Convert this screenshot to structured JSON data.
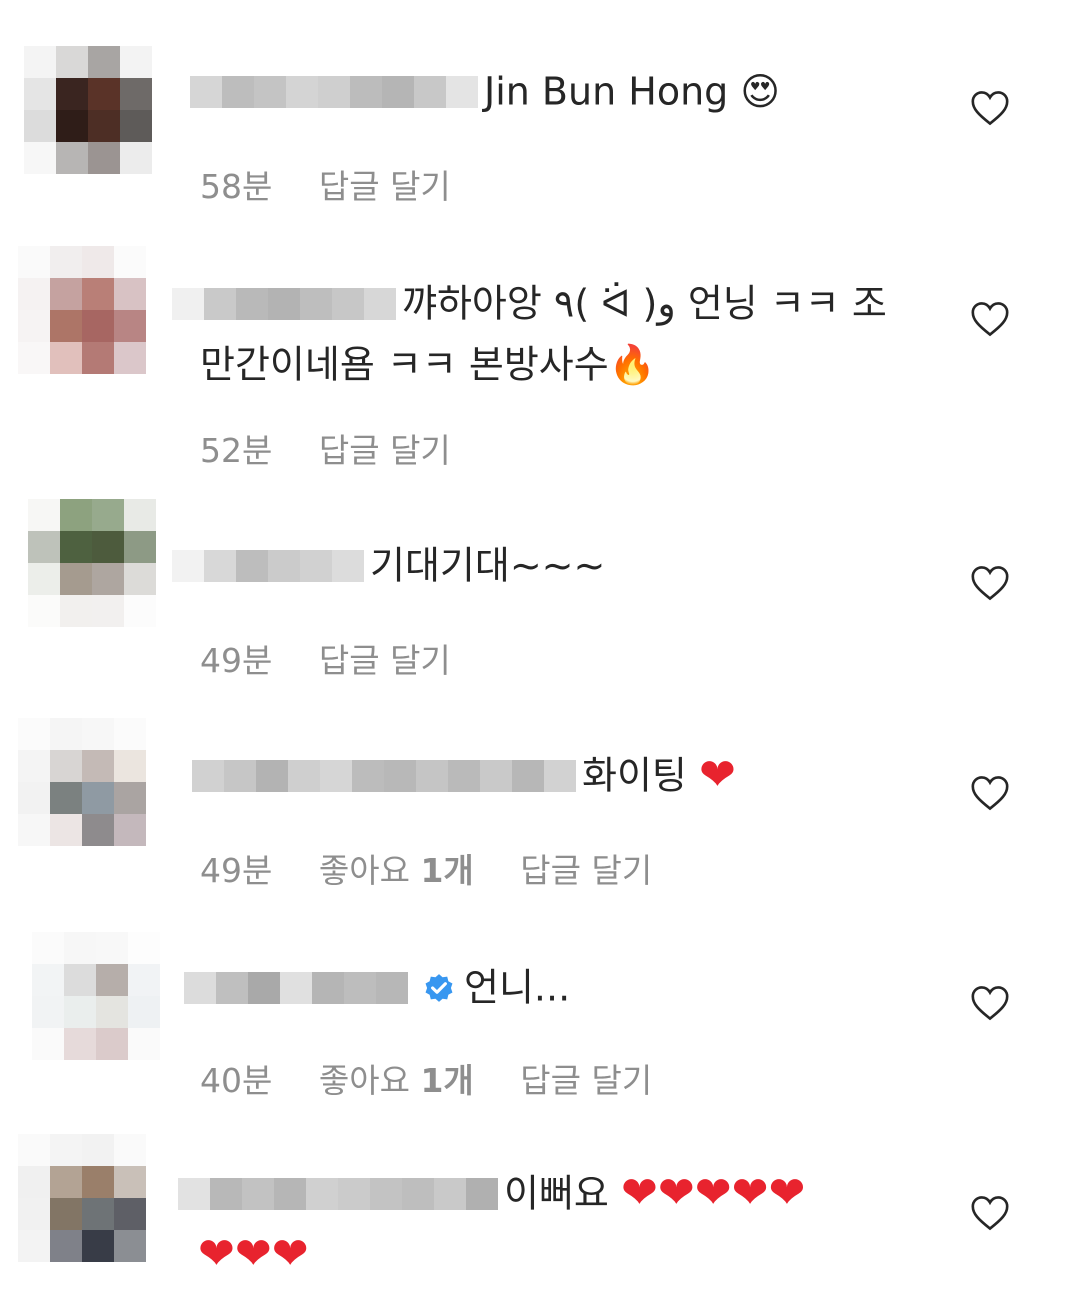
{
  "comments": [
    {
      "text_line1": "Jin Bun Hong",
      "emoji_after": "😍",
      "text_line2": "",
      "time": "58분",
      "likes": "",
      "reply": "답글 달기",
      "verified": false
    },
    {
      "text_line1": "꺄하아앙 ٩( ᐛ )و  언닝 ㅋㅋ 조",
      "emoji_after": "",
      "text_line2": "만간이네욤 ㅋㅋ 본방사수",
      "emoji_line2": "🔥",
      "time": "52분",
      "likes": "",
      "reply": "답글 달기",
      "verified": false
    },
    {
      "text_line1": "기대기대~~~",
      "emoji_after": "",
      "text_line2": "",
      "time": "49분",
      "likes": "",
      "reply": "답글 달기",
      "verified": false
    },
    {
      "text_line1": "화이팅",
      "emoji_after": "❤",
      "text_line2": "",
      "time": "49분",
      "likes": "좋아요 1개",
      "reply": "답글 달기",
      "verified": false
    },
    {
      "text_line1": "언니...",
      "emoji_after": "",
      "text_line2": "",
      "time": "40분",
      "likes": "좋아요 1개",
      "reply": "답글 달기",
      "verified": true
    },
    {
      "text_line1": "이뻐요",
      "emoji_after": "❤❤❤❤❤",
      "text_line2": "",
      "emoji_line2": "❤❤❤",
      "time": "",
      "likes": "",
      "reply": "",
      "verified": false
    }
  ],
  "colors": {
    "meta_gray": "#8e8e8e",
    "text": "#262626",
    "verified_blue": "#3897f0",
    "heart_red": "#e8232e"
  }
}
